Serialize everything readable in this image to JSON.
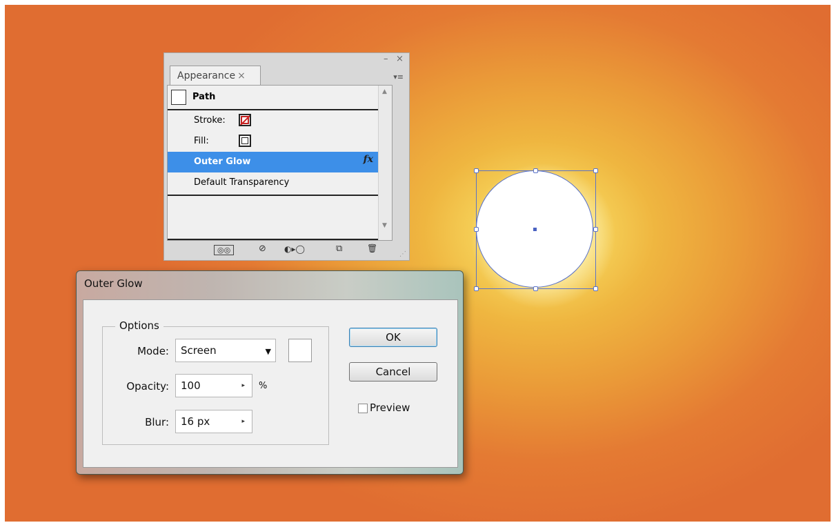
{
  "appearance_panel": {
    "tab_label": "Appearance",
    "tab_close": "×",
    "minimize": "–",
    "close": "×",
    "menu_glyph": "▾≡",
    "object_type": "Path",
    "stroke_label": "Stroke:",
    "fill_label": "Fill:",
    "effect_label": "Outer Glow",
    "fx_glyph": "fx",
    "transparency_label": "Default Transparency",
    "scroll_up": "▲",
    "scroll_down": "▼",
    "bottom_icons": [
      "add-new-stroke-icon",
      "clear-appearance-icon",
      "reduce-to-basic-icon",
      "duplicate-item-icon",
      "delete-item-icon"
    ],
    "bottom_glyphs": [
      "◎◎",
      "⊘",
      "◐▸◯",
      "⧉",
      "🗑"
    ]
  },
  "dialog": {
    "title": "Outer Glow",
    "options_legend": "Options",
    "mode_label": "Mode:",
    "mode_value": "Screen",
    "mode_arrow": "▼",
    "opacity_label": "Opacity:",
    "opacity_value": "100",
    "opacity_unit": "%",
    "blur_label": "Blur:",
    "blur_value": "16 px",
    "step_arrow": "▸",
    "ok_label": "OK",
    "cancel_label": "Cancel",
    "preview_label": "Preview",
    "preview_checked": false,
    "glow_color": "#ffffff"
  },
  "canvas": {
    "selected_shape": "circle",
    "shape_fill": "#ffffff",
    "selection_color": "#5a72c8"
  }
}
